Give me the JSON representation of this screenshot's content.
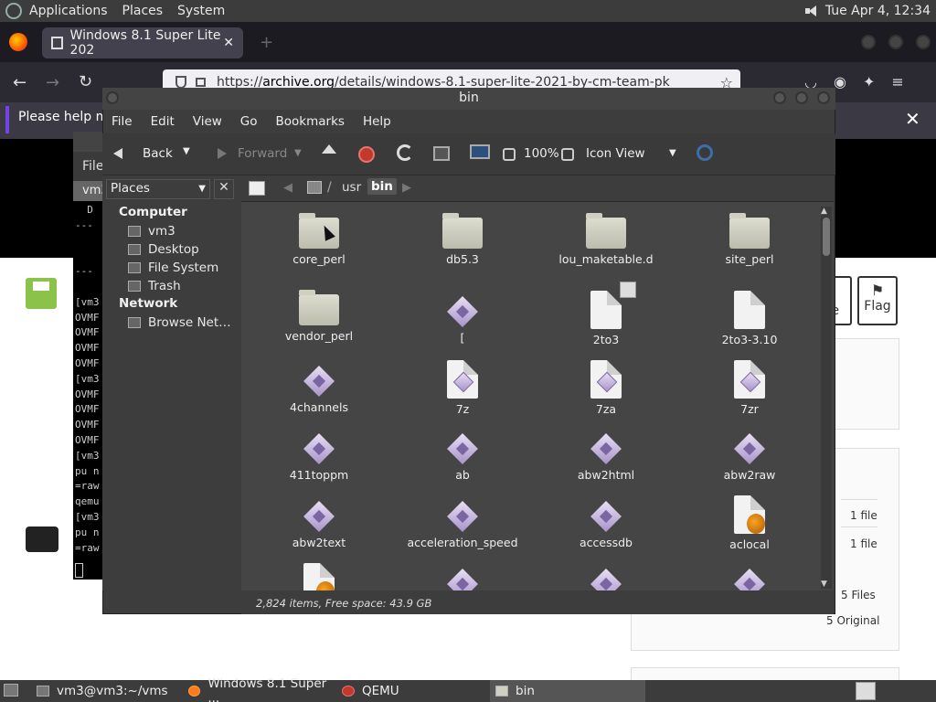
{
  "top_panel": {
    "menus": [
      "Applications",
      "Places",
      "System"
    ],
    "clock": "Tue Apr  4, 12:34"
  },
  "firefox": {
    "tab_title": "Windows 8.1 Super Lite 202",
    "url_prefix": "https://",
    "url_domain": "archive.org",
    "url_path": "/details/windows-8.1-super-lite-2021-by-cm-team-pk",
    "notification": "Please help ma"
  },
  "archive_page": {
    "share_label": "re",
    "flag_label": "Flag",
    "file_rows": [
      "1 file",
      "1 file"
    ],
    "files_count": "5 Files",
    "original_count": "5 Original"
  },
  "terminal": {
    "menu_fragment": "File",
    "tab_fragment": "vm3",
    "lines": [
      "  D",
      "---",
      "",
      "",
      "---",
      "",
      "[vm3",
      "OVMF",
      "OVMF",
      "OVMF",
      "OVMF",
      "[vm3",
      "OVMF",
      "OVMF",
      "OVMF",
      "OVMF",
      "[vm3",
      "pu n",
      "=raw",
      "qemu",
      "[vm3",
      "pu n",
      "=raw"
    ]
  },
  "file_manager": {
    "title": "bin",
    "menu": [
      "File",
      "Edit",
      "View",
      "Go",
      "Bookmarks",
      "Help"
    ],
    "toolbar": {
      "back": "Back",
      "forward": "Forward",
      "zoom": "100%",
      "view_mode": "Icon View"
    },
    "sidebar": {
      "combo_label": "Places",
      "computer_heading": "Computer",
      "computer_items": [
        "vm3",
        "Desktop",
        "File System",
        "Trash"
      ],
      "network_heading": "Network",
      "network_items": [
        "Browse Net…"
      ]
    },
    "path": {
      "separator": "/",
      "segments": [
        "usr",
        "bin"
      ]
    },
    "items": [
      {
        "name": "core_perl",
        "type": "folder"
      },
      {
        "name": "db5.3",
        "type": "folder"
      },
      {
        "name": "lou_maketable.d",
        "type": "folder"
      },
      {
        "name": "site_perl",
        "type": "folder"
      },
      {
        "name": "vendor_perl",
        "type": "folder"
      },
      {
        "name": "[",
        "type": "exec"
      },
      {
        "name": "2to3",
        "type": "page"
      },
      {
        "name": "2to3-3.10",
        "type": "page"
      },
      {
        "name": "4channels",
        "type": "exec"
      },
      {
        "name": "7z",
        "type": "page-exec"
      },
      {
        "name": "7za",
        "type": "page-exec"
      },
      {
        "name": "7zr",
        "type": "page-exec"
      },
      {
        "name": "411toppm",
        "type": "exec"
      },
      {
        "name": "ab",
        "type": "exec"
      },
      {
        "name": "abw2html",
        "type": "exec"
      },
      {
        "name": "abw2raw",
        "type": "exec"
      },
      {
        "name": "abw2text",
        "type": "exec"
      },
      {
        "name": "acceleration_speed",
        "type": "exec"
      },
      {
        "name": "accessdb",
        "type": "exec"
      },
      {
        "name": "aclocal",
        "type": "script"
      }
    ],
    "status": "2,824 items, Free space: 43.9 GB"
  },
  "taskbar": {
    "items": [
      "vm3@vm3:~/vms",
      "Windows 8.1 Super ...",
      "QEMU",
      "bin"
    ]
  }
}
